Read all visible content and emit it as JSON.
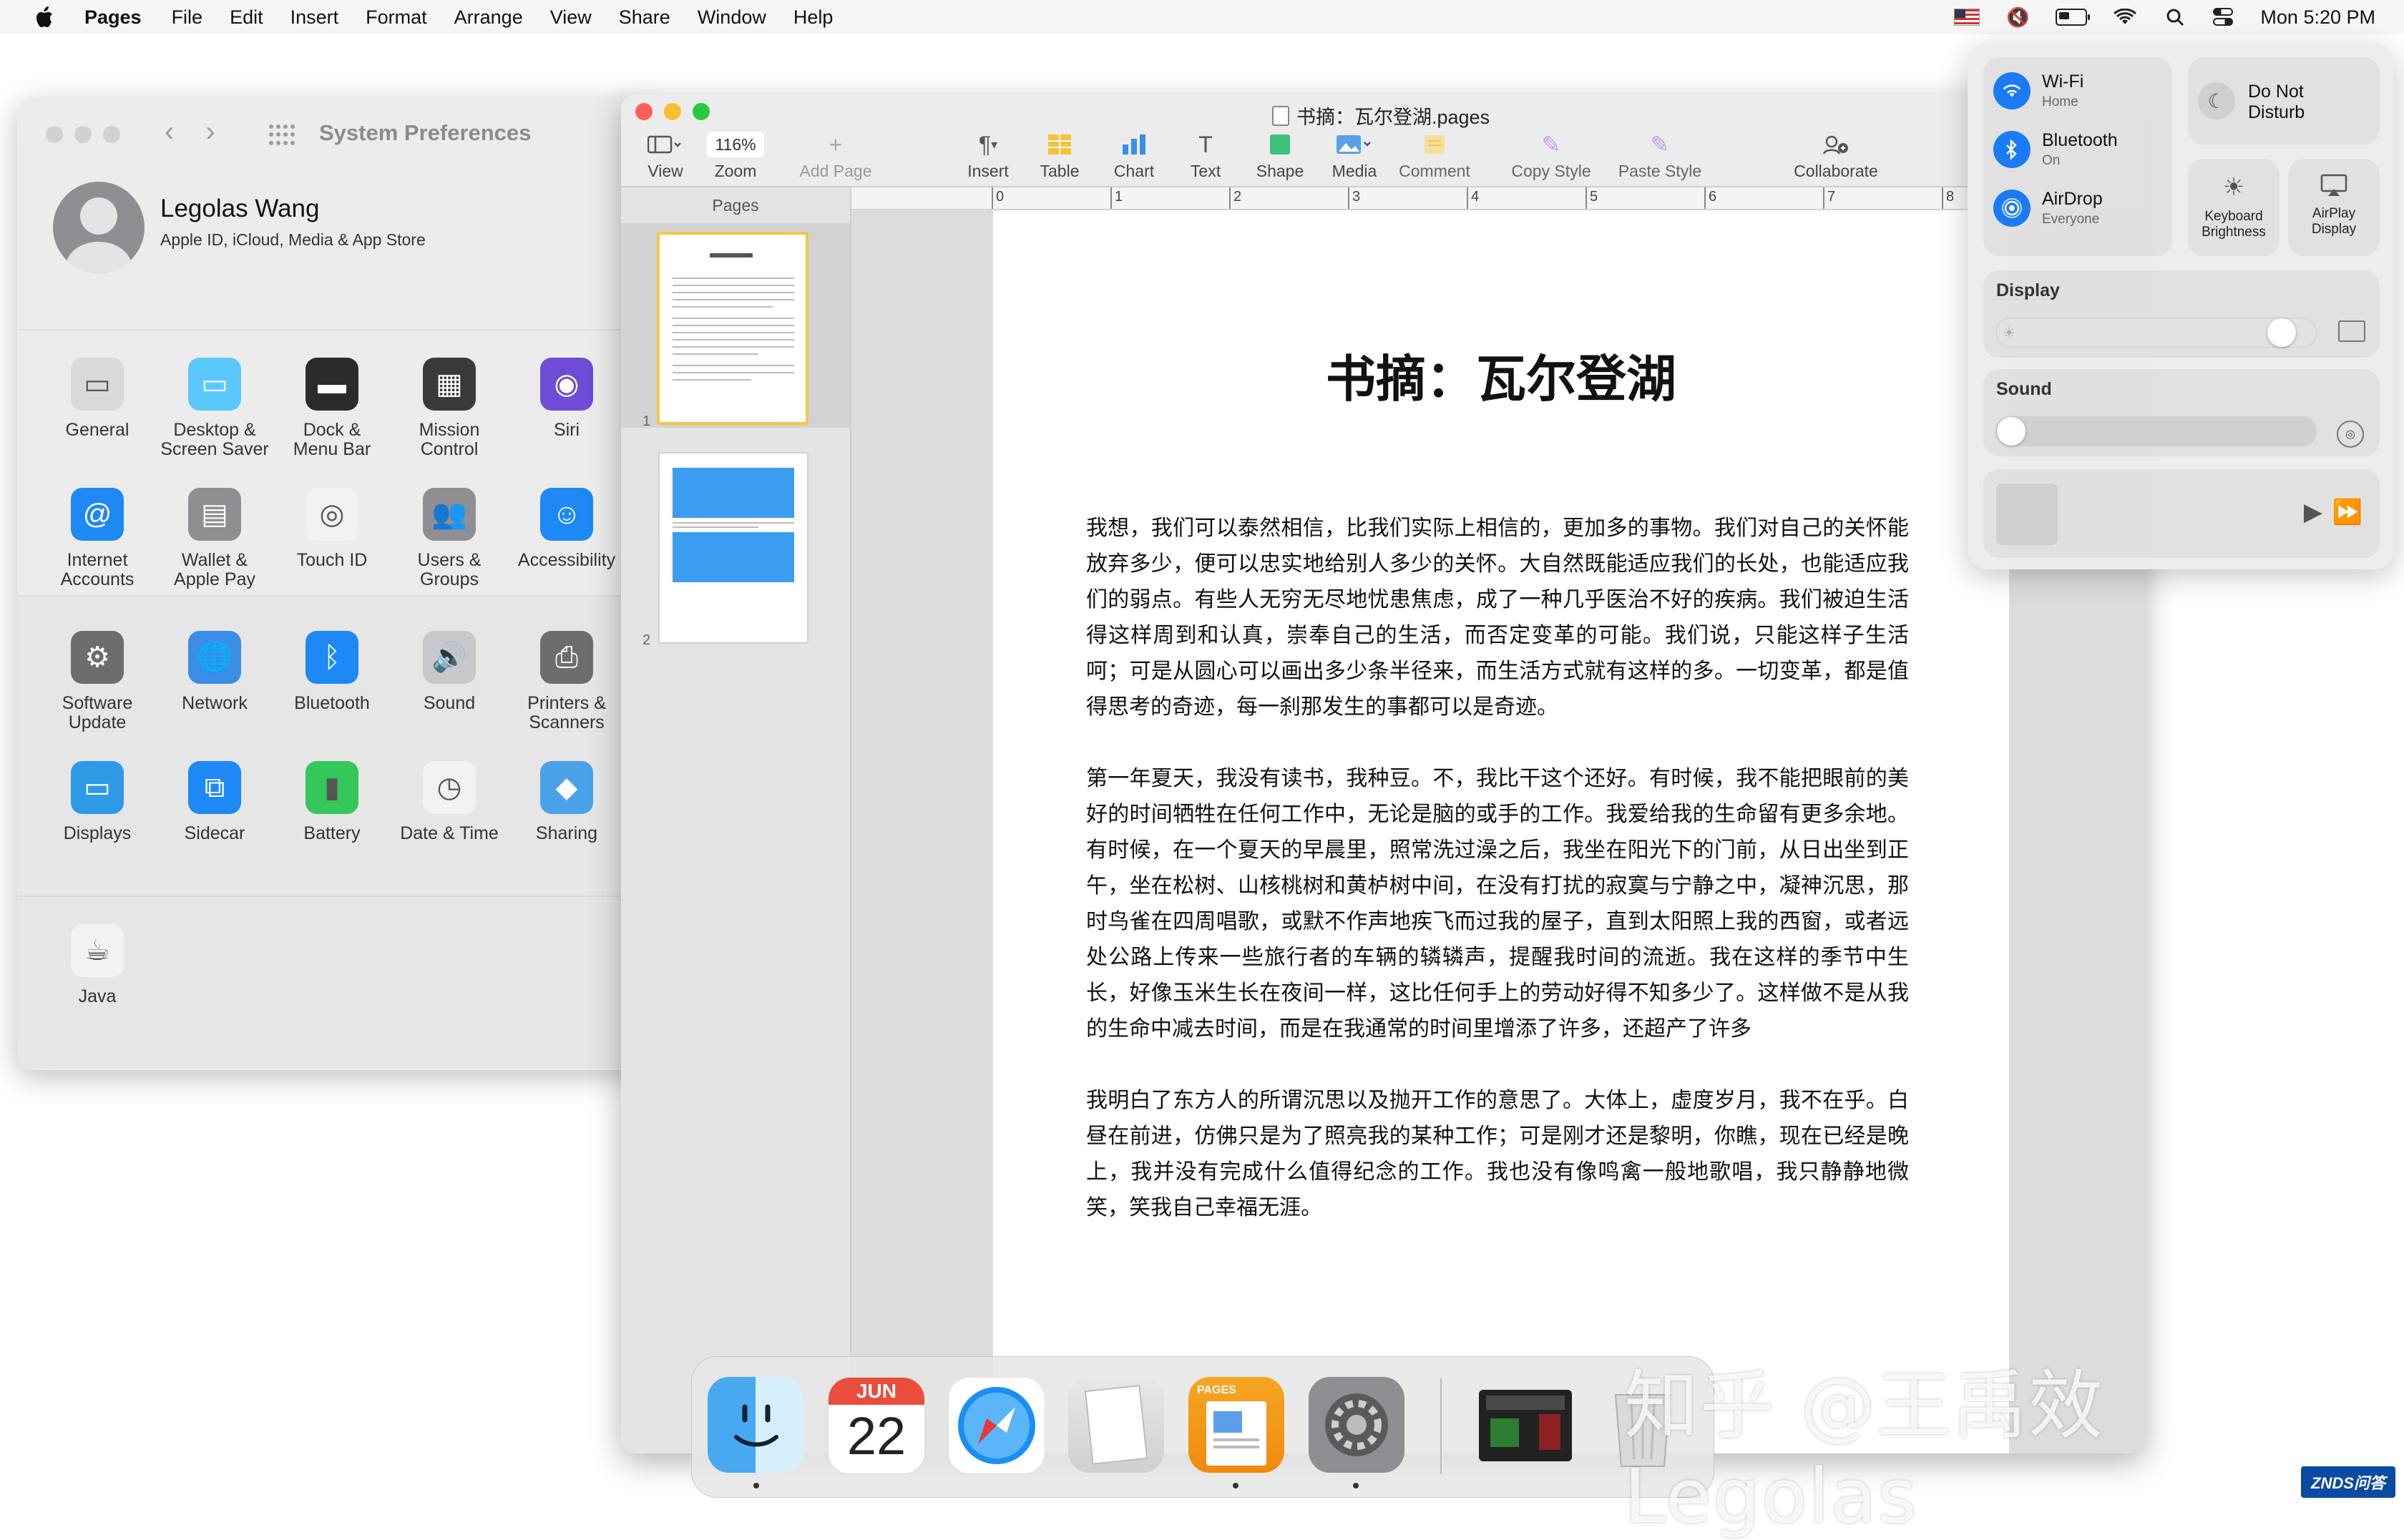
{
  "menubar": {
    "app_name": "Pages",
    "items": [
      "File",
      "Edit",
      "Insert",
      "Format",
      "Arrange",
      "View",
      "Share",
      "Window",
      "Help"
    ],
    "clock": "Mon 5:20 PM"
  },
  "system_preferences": {
    "title": "System Preferences",
    "user": {
      "name": "Legolas Wang",
      "subtitle": "Apple ID, iCloud, Media & App Store"
    },
    "section1": [
      {
        "label": "General",
        "icon": "general-icon",
        "color": "#d9d9d9"
      },
      {
        "label": "Desktop &\nScreen Saver",
        "icon": "desktop-icon",
        "color": "#5ac8fa"
      },
      {
        "label": "Dock &\nMenu Bar",
        "icon": "dock-icon",
        "color": "#2b2b2b"
      },
      {
        "label": "Mission\nControl",
        "icon": "mission-control-icon",
        "color": "#3a3a3c"
      },
      {
        "label": "Siri",
        "icon": "siri-icon",
        "color": "#6e4cd6"
      },
      {
        "label": "Internet\nAccounts",
        "icon": "at-icon",
        "color": "#1e88f5"
      },
      {
        "label": "Wallet &\nApple Pay",
        "icon": "wallet-icon",
        "color": "#8e8e93"
      },
      {
        "label": "Touch ID",
        "icon": "fingerprint-icon",
        "color": "#f2f2f2"
      },
      {
        "label": "Users &\nGroups",
        "icon": "users-icon",
        "color": "#8e8e93"
      },
      {
        "label": "Accessibility",
        "icon": "accessibility-icon",
        "color": "#1e88f5"
      }
    ],
    "section2": [
      {
        "label": "Software\nUpdate",
        "icon": "software-update-icon",
        "color": "#6d6d70"
      },
      {
        "label": "Network",
        "icon": "network-icon",
        "color": "#3b8ee8"
      },
      {
        "label": "Bluetooth",
        "icon": "bluetooth-icon",
        "color": "#1e88f5"
      },
      {
        "label": "Sound",
        "icon": "sound-icon",
        "color": "#c7c7cc"
      },
      {
        "label": "Printers &\nScanners",
        "icon": "printer-icon",
        "color": "#6d6d70"
      },
      {
        "label": "Displays",
        "icon": "displays-icon",
        "color": "#2e9ae6"
      },
      {
        "label": "Sidecar",
        "icon": "sidecar-icon",
        "color": "#1e88f5"
      },
      {
        "label": "Battery",
        "icon": "battery-icon",
        "color": "#34c759"
      },
      {
        "label": "Date & Time",
        "icon": "clock-icon",
        "color": "#f2f2f2"
      },
      {
        "label": "Sharing",
        "icon": "sharing-icon",
        "color": "#4aa3e8"
      }
    ],
    "section3": [
      {
        "label": "Java",
        "icon": "java-icon",
        "color": "#f2f2f2"
      }
    ]
  },
  "pages": {
    "title": "书摘：瓦尔登湖.pages",
    "toolbar": {
      "view": "View",
      "zoom_value": "116%",
      "zoom": "Zoom",
      "add_page": "Add Page",
      "insert": "Insert",
      "table": "Table",
      "chart": "Chart",
      "text": "Text",
      "shape": "Shape",
      "media": "Media",
      "comment": "Comment",
      "copy_style": "Copy Style",
      "paste_style": "Paste Style",
      "collaborate": "Collaborate"
    },
    "sidebar_header": "Pages",
    "thumb_numbers": [
      "1",
      "2"
    ],
    "ruler_marks": [
      "0",
      "1",
      "2",
      "3",
      "4",
      "5",
      "6",
      "7",
      "8"
    ],
    "doc": {
      "title": "书摘：瓦尔登湖",
      "paragraphs": [
        "我想，我们可以泰然相信，比我们实际上相信的，更加多的事物。我们对自己的关怀能放弃多少，便可以忠实地给别人多少的关怀。大自然既能适应我们的长处，也能适应我们的弱点。有些人无穷无尽地忧患焦虑，成了一种几乎医治不好的疾病。我们被迫生活得这样周到和认真，崇奉自己的生活，而否定变革的可能。我们说，只能这样子生活呵；可是从圆心可以画出多少条半径来，而生活方式就有这样的多。一切变革，都是值得思考的奇迹，每一刹那发生的事都可以是奇迹。",
        "第一年夏天，我没有读书，我种豆。不，我比干这个还好。有时候，我不能把眼前的美好的时间牺牲在任何工作中，无论是脑的或手的工作。我爱给我的生命留有更多余地。有时候，在一个夏天的早晨里，照常洗过澡之后，我坐在阳光下的门前，从日出坐到正午，坐在松树、山核桃树和黄栌树中间，在没有打扰的寂寞与宁静之中，凝神沉思，那时鸟雀在四周唱歌，或默不作声地疾飞而过我的屋子，直到太阳照上我的西窗，或者远处公路上传来一些旅行者的车辆的辚辚声，提醒我时间的流逝。我在这样的季节中生长，好像玉米生长在夜间一样，这比任何手上的劳动好得不知多少了。这样做不是从我的生命中减去时间，而是在我通常的时间里增添了许多，还超产了许多",
        "我明白了东方人的所谓沉思以及抛开工作的意思了。大体上，虚度岁月，我不在乎。白昼在前进，仿佛只是为了照亮我的某种工作；可是刚才还是黎明，你瞧，现在已经是晚上，我并没有完成什么值得纪念的工作。我也没有像鸣禽一般地歌唱，我只静静地微笑，笑我自己幸福无涯。"
      ]
    }
  },
  "control_center": {
    "wifi": {
      "title": "Wi-Fi",
      "status": "Home"
    },
    "bluetooth": {
      "title": "Bluetooth",
      "status": "On"
    },
    "airdrop": {
      "title": "AirDrop",
      "status": "Everyone"
    },
    "dnd": "Do Not\nDisturb",
    "keyboard": "Keyboard\nBrightness",
    "airplay": "AirPlay\nDisplay",
    "display_label": "Display",
    "display_level": 0.93,
    "sound_label": "Sound",
    "sound_level": 0.0
  },
  "dock": {
    "calendar_month": "JUN",
    "calendar_day": "22",
    "pages_label": "PAGES"
  },
  "watermark": "知乎 @王禹效 Legolas",
  "badge": "ZNDS问答"
}
